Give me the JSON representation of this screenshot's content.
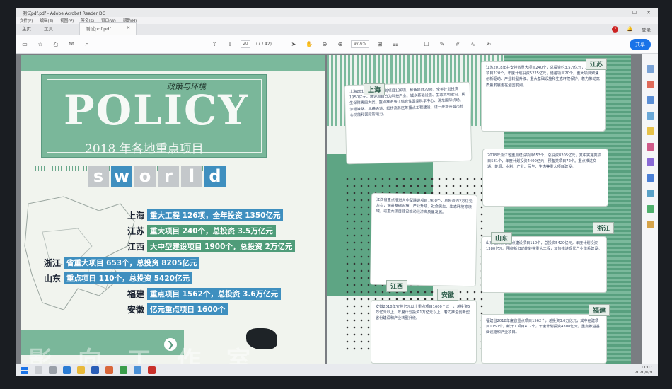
{
  "window": {
    "title": "测试pdf.pdf - Adobe Acrobat Reader DC",
    "controls": [
      "—",
      "☐",
      "✕"
    ]
  },
  "menu": [
    "文件(F)",
    "编辑(E)",
    "视图(V)",
    "签名(S)",
    "窗口(W)",
    "帮助(H)"
  ],
  "tabs": {
    "home": "主页",
    "tools": "工具",
    "document": "测试pdf.pdf",
    "login": "登录"
  },
  "toolbar": {
    "page_current": "20",
    "page_total": "(7 / 42)",
    "zoom": "97.6%",
    "share_label": "共享"
  },
  "left_page": {
    "headline": "POLICY",
    "handwritten": "政策与环境",
    "subtitle": "2018 年各地重点项目",
    "sworld_letters": [
      "s",
      "w",
      "o",
      "r",
      "l",
      "d"
    ],
    "stats": [
      {
        "province": "上海",
        "text": "重大工程 126项，全年投资 1350亿元"
      },
      {
        "province": "江苏",
        "text": "重大项目 240个，总投资 3.5万亿元"
      },
      {
        "province": "江西",
        "text": "大中型建设项目 1900个，总投资 2万亿元"
      },
      {
        "province": "浙江",
        "text": "省重大项目 653个，总投资 8205亿元"
      },
      {
        "province": "山东",
        "text": "重点项目 110个，总投资 5420亿元"
      },
      {
        "province": "福建",
        "text": "重点项目 1562个，总投资 3.6万亿元"
      },
      {
        "province": "安徽",
        "text": "亿元重点项目 1600个"
      }
    ],
    "watermark": "影向工作室"
  },
  "right_page": {
    "cards": [
      {
        "title": "上海",
        "text": "上海2018年共安排计划项目126项，预备项目22项，全年计划投资1350亿元，建设项目分为科技产业、城乡基础设施、生态文明建设、民生保障等四大类。重点推进张江综合性国家科学中心、浦东国际机场、沪通铁路、北横通道、虹桥商务区等重点工程建设，进一步提升城市核心功能和国际影响力。"
      },
      {
        "title": "江苏",
        "text": "江苏2018年共安排省重大项目240个，总投资约3.5万亿元，其中实施项目220个，年度计划投资5225亿元，储备项目20个。重大项目聚焦创新驱动、产业转型升级、重大基础设施和生态环境保护，着力推动高质量发展走在全国前列。"
      },
      {
        "title": "浙江",
        "text": "2018年浙江省重点建设项目653个，总投资8205亿元，其中实施类项目581个，年度计划投资4400亿元，预备类项目72个。重点推进交通、能源、水利、产业、民生、生态等重大项目建设。"
      },
      {
        "title": "江西",
        "text": "江西省重点推进大中型建设项目1900个，总投资约2万亿元左右，涵盖基础设施、产业升级、社会民生、生态环境等领域，以重大项目建设推动经济高质量发展。"
      },
      {
        "title": "山东",
        "text": "山东省安排省重点建设项目110个，总投资5420亿元，年度计划投资1380亿元，围绕新旧动能转换重大工程，加快推进现代产业体系建设。"
      },
      {
        "title": "安徽",
        "text": "安徽2018年安排亿元以上重点项目1600个以上，总投资5万亿元以上，年度计划投资1万亿元以上，着力推进创新型省份建设和产业转型升级。"
      },
      {
        "title": "福建",
        "text": "福建省2018年度省重点项目1562个，总投资3.6万亿元，其中在建项目1150个，新开工项目412个，年度计划投资4308亿元，重点推进基础设施和产业项目。"
      }
    ]
  },
  "taskbar": {
    "time": "11:07",
    "date": "2020/6/9"
  },
  "colors": {
    "accent_blue": "#3f8fbf",
    "brand_green": "#7ab79a",
    "share_blue": "#1a73e8"
  }
}
